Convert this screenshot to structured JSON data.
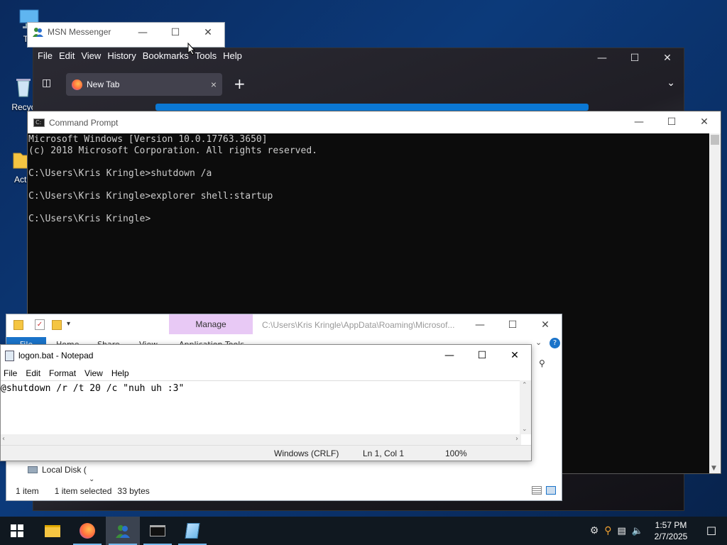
{
  "desktop": {
    "icons": [
      {
        "label": "Thi",
        "icon": "computer-icon"
      },
      {
        "label": "Recyc",
        "icon": "recycle-bin-icon"
      },
      {
        "label": "Activ",
        "icon": "folder-icon"
      }
    ]
  },
  "msn": {
    "title": "MSN Messenger"
  },
  "firefox": {
    "menu": [
      "File",
      "Edit",
      "View",
      "History",
      "Bookmarks",
      "Tools",
      "Help"
    ],
    "tab_label": "New Tab",
    "tab_close": "×",
    "new_tab": "+"
  },
  "cmd": {
    "title": "Command Prompt",
    "lines": [
      "Microsoft Windows [Version 10.0.17763.3650]",
      "(c) 2018 Microsoft Corporation. All rights reserved.",
      "",
      "C:\\Users\\Kris Kringle>shutdown /a",
      "",
      "C:\\Users\\Kris Kringle>explorer shell:startup",
      "",
      "C:\\Users\\Kris Kringle>"
    ]
  },
  "explorer": {
    "manage": "Manage",
    "path": "C:\\Users\\Kris Kringle\\AppData\\Roaming\\Microsof...",
    "ribbon_tabs": [
      "File",
      "Home",
      "Share",
      "View",
      "Application Tools"
    ],
    "nav_item": "Local Disk (",
    "status_items": "1 item",
    "status_selected": "1 item selected",
    "status_size": "33 bytes"
  },
  "notepad": {
    "title": "logon.bat - Notepad",
    "menu": [
      "File",
      "Edit",
      "Format",
      "View",
      "Help"
    ],
    "content": "@shutdown /r /t 20 /c \"nuh uh :3\"",
    "status_eol": "Windows (CRLF)",
    "status_pos": "Ln 1, Col 1",
    "status_zoom": "100%"
  },
  "taskbar": {
    "time": "1:57 PM",
    "date": "2/7/2025",
    "apps": [
      "file-explorer-icon",
      "firefox-icon",
      "msn-messenger-icon",
      "command-prompt-icon",
      "notepad-icon"
    ]
  },
  "colors": {
    "accent": "#0b78d4",
    "manage_bg": "#e8c9f5",
    "taskbar": "#101820"
  }
}
